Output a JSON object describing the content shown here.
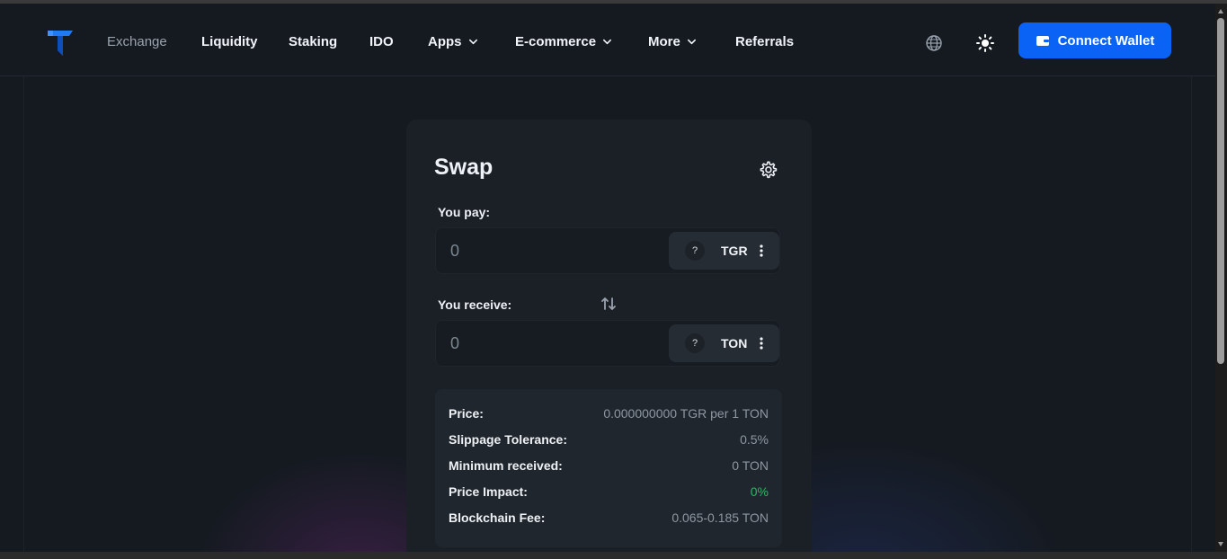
{
  "nav": {
    "exchange": "Exchange",
    "liquidity": "Liquidity",
    "staking": "Staking",
    "ido": "IDO",
    "apps": "Apps",
    "ecommerce": "E-commerce",
    "more": "More",
    "referrals": "Referrals"
  },
  "header": {
    "connect_label": "Connect Wallet",
    "accent": "#0b63f6"
  },
  "swap": {
    "title": "Swap",
    "pay_label": "You pay:",
    "pay_amount": "0",
    "pay_token_icon": "?",
    "pay_token": "TGR",
    "receive_label": "You receive:",
    "receive_amount": "0",
    "receive_token_icon": "?",
    "receive_token": "TON"
  },
  "details": {
    "price_label": "Price:",
    "price_value": "0.000000000 TGR per 1 TON",
    "slippage_label": "Slippage Tolerance:",
    "slippage_value": "0.5%",
    "min_received_label": "Minimum received:",
    "min_received_value": "0 TON",
    "impact_label": "Price Impact:",
    "impact_value": "0%",
    "fee_label": "Blockchain Fee:",
    "fee_value": "0.065-0.185 TON",
    "impact_color": "#2bb863"
  },
  "icons": {
    "logo": "logo-icon",
    "globe": "globe-icon",
    "theme": "sun-icon",
    "wallet": "wallet-icon",
    "settings": "gear-icon",
    "swap": "swap-arrows-icon",
    "token_menu": "more-vertical-icon",
    "chevron": "chevron-down-icon"
  }
}
